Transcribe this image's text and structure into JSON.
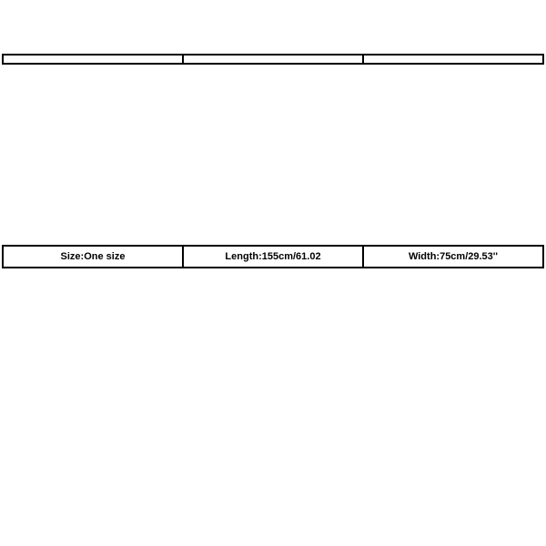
{
  "table": {
    "rows": [
      {
        "size": "Size:One size",
        "length": "Length:155cm/61.02",
        "width": "Width:75cm/29.53''"
      }
    ]
  }
}
